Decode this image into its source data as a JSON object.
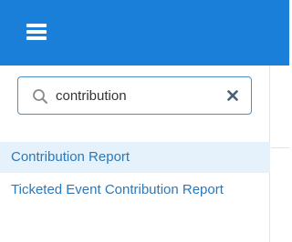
{
  "header": {
    "accent_color": "#1a7fd9",
    "menu_icon": "hamburger-menu-icon"
  },
  "search": {
    "value": "contribution",
    "search_icon": "search-icon",
    "clear_icon": "close-icon",
    "border_color": "#4a90c8"
  },
  "results": [
    {
      "label": "Contribution Report",
      "active": true
    },
    {
      "label": "Ticketed Event Contribution Report",
      "active": false
    }
  ],
  "colors": {
    "link": "#2b78b8",
    "active_background": "#e6f2fb"
  }
}
